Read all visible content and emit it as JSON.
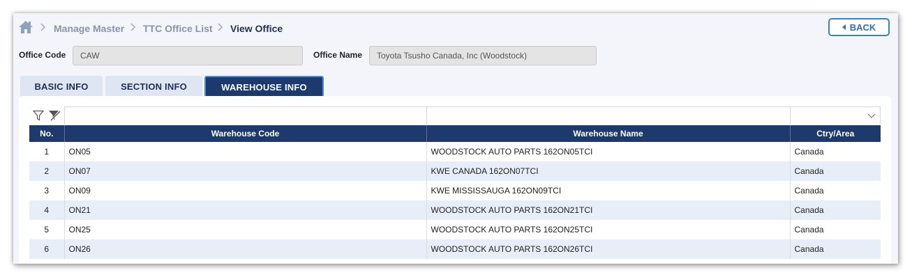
{
  "breadcrumb": {
    "home_icon": "home-icon",
    "items": [
      "Manage Master",
      "TTC Office List",
      "View Office"
    ]
  },
  "back_button": {
    "label": "BACK",
    "icon": "caret-left-icon"
  },
  "office": {
    "code_label": "Office Code",
    "code_value": "CAW",
    "name_label": "Office Name",
    "name_value": "Toyota Tsusho Canada, Inc (Woodstock)"
  },
  "tabs": [
    {
      "label": "BASIC INFO",
      "active": false
    },
    {
      "label": "SECTION INFO",
      "active": false
    },
    {
      "label": "WAREHOUSE INFO",
      "active": true
    }
  ],
  "toolbar": {
    "filter_icon": "filter-icon",
    "clear_filter_icon": "clear-filter-icon",
    "dropdown_icon": "chevron-down-icon"
  },
  "table": {
    "headers": [
      "No.",
      "Warehouse Code",
      "Warehouse Name",
      "Ctry/Area"
    ],
    "rows": [
      [
        "1",
        "ON05",
        "WOODSTOCK AUTO PARTS 162ON05TCI",
        "Canada"
      ],
      [
        "2",
        "ON07",
        "KWE CANADA 162ON07TCI",
        "Canada"
      ],
      [
        "3",
        "ON09",
        "KWE MISSISSAUGA 162ON09TCI",
        "Canada"
      ],
      [
        "4",
        "ON21",
        "WOODSTOCK AUTO PARTS 162ON21TCI",
        "Canada"
      ],
      [
        "5",
        "ON25",
        "WOODSTOCK AUTO PARTS 162ON25TCI",
        "Canada"
      ],
      [
        "6",
        "ON26",
        "WOODSTOCK AUTO PARTS 162ON26TCI",
        "Canada"
      ]
    ]
  },
  "colors": {
    "header_navy": "#1e3a6d",
    "tab_active": "#1d3a6e",
    "accent_blue": "#3b82c4",
    "row_alt": "#e8eef8"
  }
}
